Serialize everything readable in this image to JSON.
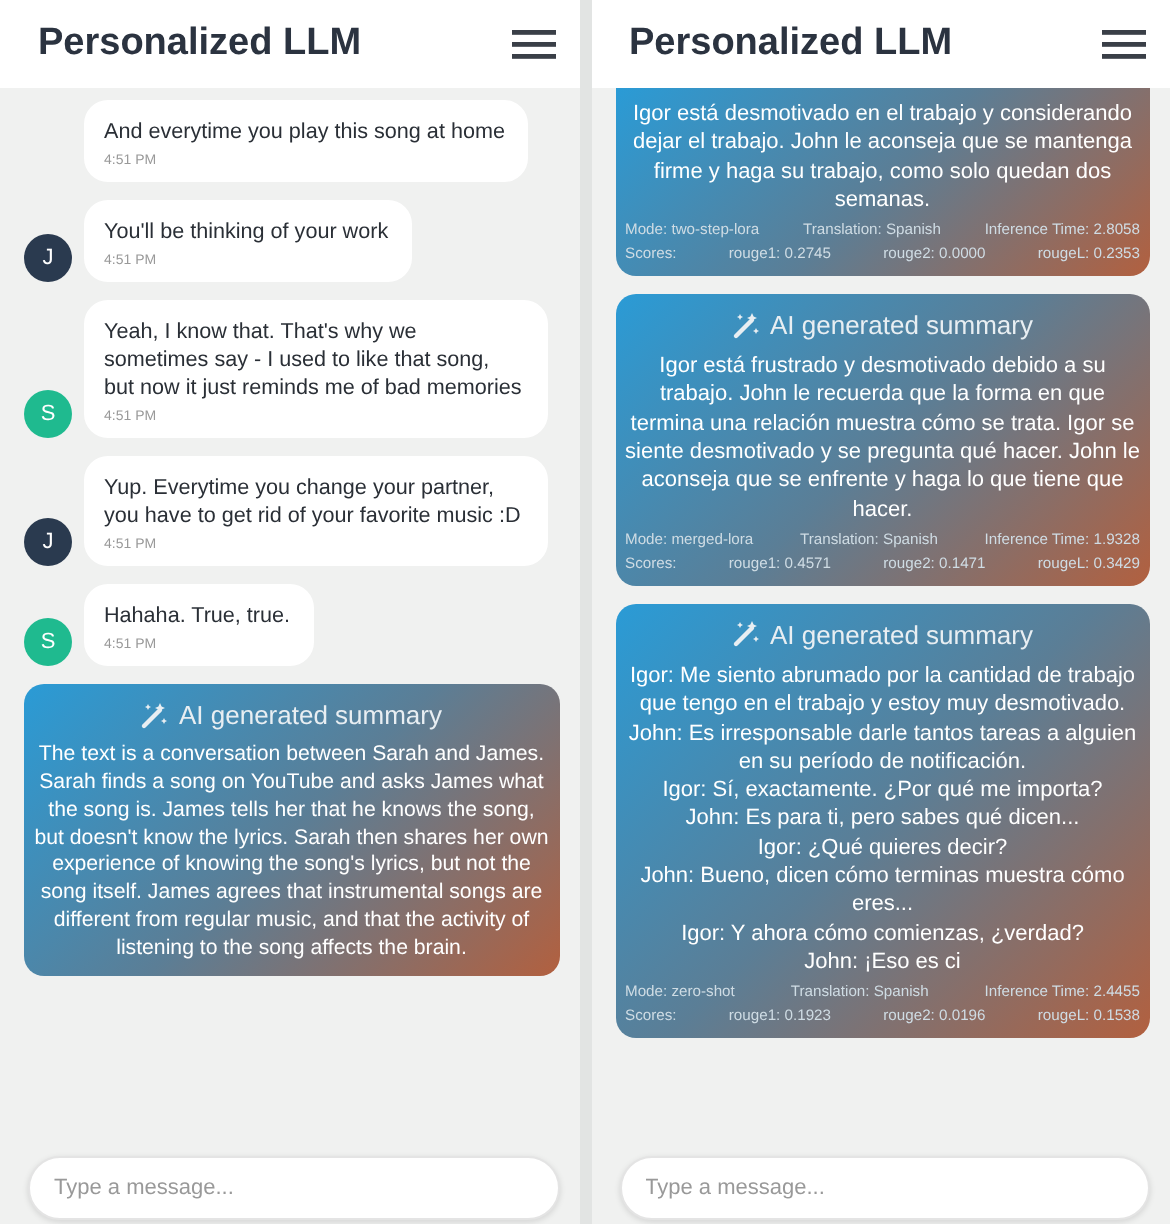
{
  "panels": [
    {
      "title": "Personalized LLM",
      "messages": [
        {
          "text": "And everytime you play this song at home",
          "time": "4:51 PM"
        },
        {
          "text": "You'll be thinking of your work",
          "time": "4:51 PM",
          "avatar": "J",
          "color": "#2a3a4f"
        },
        {
          "text": "Yeah, I know that. That's why we sometimes say - I used to like that song, but now it just reminds me of bad memories",
          "time": "4:51 PM",
          "avatar": "S",
          "color": "#1fba8f"
        },
        {
          "text": "Yup. Everytime you change your partner, you have to get rid of your favorite music :D",
          "time": "4:51 PM",
          "avatar": "J",
          "color": "#2a3a4f"
        },
        {
          "text": "Hahaha. True, true.",
          "time": "4:51 PM",
          "avatar": "S",
          "color": "#1fba8f"
        }
      ],
      "summaries": [
        {
          "title": "AI generated summary",
          "text": "The text is a conversation between Sarah and James. Sarah finds a song on YouTube and asks James what the song is. James tells her that he knows the song, but doesn't know the lyrics. Sarah then shares her own experience of knowing the song's lyrics, but not the song itself. James agrees that instrumental songs are different from regular music, and that the activity of listening to the song affects the brain."
        }
      ],
      "input": {
        "placeholder": "Type a message..."
      }
    },
    {
      "title": "Personalized LLM",
      "summaries": [
        {
          "text": "Igor está desmotivado en el trabajo y considerando dejar el trabajo. John le aconseja que se mantenga firme y haga su trabajo, como solo quedan dos semanas.",
          "meta": [
            "Mode: two-step-lora",
            "Translation: Spanish",
            "Inference Time: 2.8058"
          ],
          "scores": [
            "Scores:",
            "rouge1: 0.2745",
            "rouge2: 0.0000",
            "rougeL: 0.2353"
          ]
        },
        {
          "title": "AI generated summary",
          "text": "Igor está frustrado y desmotivado debido a su trabajo. John le recuerda que la forma en que termina una relación muestra cómo se trata. Igor se siente desmotivado y se pregunta qué hacer. John le aconseja que se enfrente y haga lo que tiene que hacer.",
          "meta": [
            "Mode: merged-lora",
            "Translation: Spanish",
            "Inference Time: 1.9328"
          ],
          "scores": [
            "Scores:",
            "rouge1: 0.4571",
            "rouge2: 0.1471",
            "rougeL: 0.3429"
          ]
        },
        {
          "title": "AI generated summary",
          "text": "Igor: Me siento abrumado por la cantidad de trabajo que tengo en el trabajo y estoy muy desmotivado.\nJohn: Es irresponsable darle tantos tareas a alguien en su período de notificación.\nIgor: Sí, exactamente. ¿Por qué me importa?\nJohn: Es para ti, pero sabes qué dicen...\nIgor: ¿Qué quieres decir?\nJohn: Bueno, dicen cómo terminas muestra cómo eres...\nIgor: Y ahora cómo comienzas, ¿verdad?\nJohn: ¡Eso es ci",
          "meta": [
            "Mode: zero-shot",
            "Translation: Spanish",
            "Inference Time: 2.4455"
          ],
          "scores": [
            "Scores:",
            "rouge1: 0.1923",
            "rouge2: 0.0196",
            "rougeL: 0.1538"
          ]
        }
      ],
      "input": {
        "placeholder": "Type a message..."
      }
    }
  ]
}
